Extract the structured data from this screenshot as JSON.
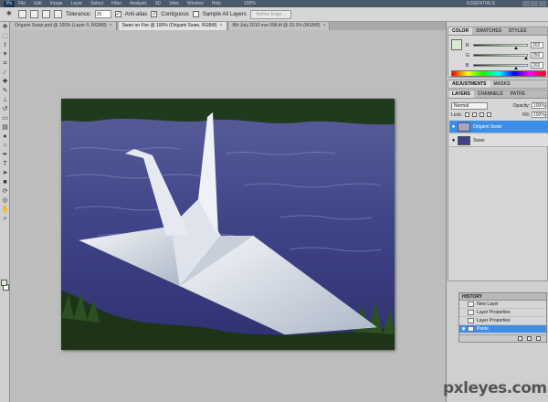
{
  "menubar": {
    "logo": "Ps",
    "items": [
      "File",
      "Edit",
      "Image",
      "Layer",
      "Select",
      "Filter",
      "Analysis",
      "3D",
      "View",
      "Window",
      "Help"
    ],
    "zoom": "100%",
    "workspace": "ESSENTIALS"
  },
  "options": {
    "tool_icon": "magic-wand-icon",
    "tolerance_label": "Tolerance:",
    "tolerance_value": "25",
    "antialias_label": "Anti-alias",
    "contiguous_label": "Contiguous",
    "sample_all_label": "Sample All Layers",
    "refine_edge_label": "Refine Edge..."
  },
  "tabs": [
    {
      "label": "Origami Swan.psd @ 100% (Layer 0, RGB/8)",
      "active": false
    },
    {
      "label": "Swan on Fire @ 100% (Origami Swan, RGB/8)",
      "active": true
    },
    {
      "label": "8th July 2010 eve 098.tif @ 33.3% (RGB/8)",
      "active": false
    }
  ],
  "color_panel": {
    "tabs": [
      "COLOR",
      "SWATCHES",
      "STYLES"
    ],
    "channels": [
      {
        "name": "R",
        "value": "202",
        "level": 0.79
      },
      {
        "name": "G",
        "value": "250",
        "level": 0.98
      },
      {
        "name": "B",
        "value": "202",
        "level": 0.79
      }
    ],
    "foreground": "#cafaca"
  },
  "adjustments": {
    "tabs": [
      "ADJUSTMENTS",
      "MASKS"
    ]
  },
  "layers_panel": {
    "tabs": [
      "LAYERS",
      "CHANNELS",
      "PATHS"
    ],
    "blend_mode": "Normal",
    "opacity_label": "Opacity:",
    "opacity_value": "100%",
    "lock_label": "Lock:",
    "fill_label": "Fill:",
    "fill_value": "100%",
    "layers": [
      {
        "name": "Origami Swan",
        "selected": true
      },
      {
        "name": "Swan",
        "selected": false
      }
    ]
  },
  "history_panel": {
    "title": "HISTORY",
    "items": [
      {
        "label": "New Layer",
        "selected": false
      },
      {
        "label": "Layer Properties",
        "selected": false
      },
      {
        "label": "Layer Properties",
        "selected": false
      },
      {
        "label": "Paste",
        "selected": true
      }
    ]
  },
  "watermark": "pxleyes.com",
  "colors": {
    "accent_selection": "#3d8ee8",
    "water": "#4a4f8f",
    "swan": "#e8ecf2"
  }
}
